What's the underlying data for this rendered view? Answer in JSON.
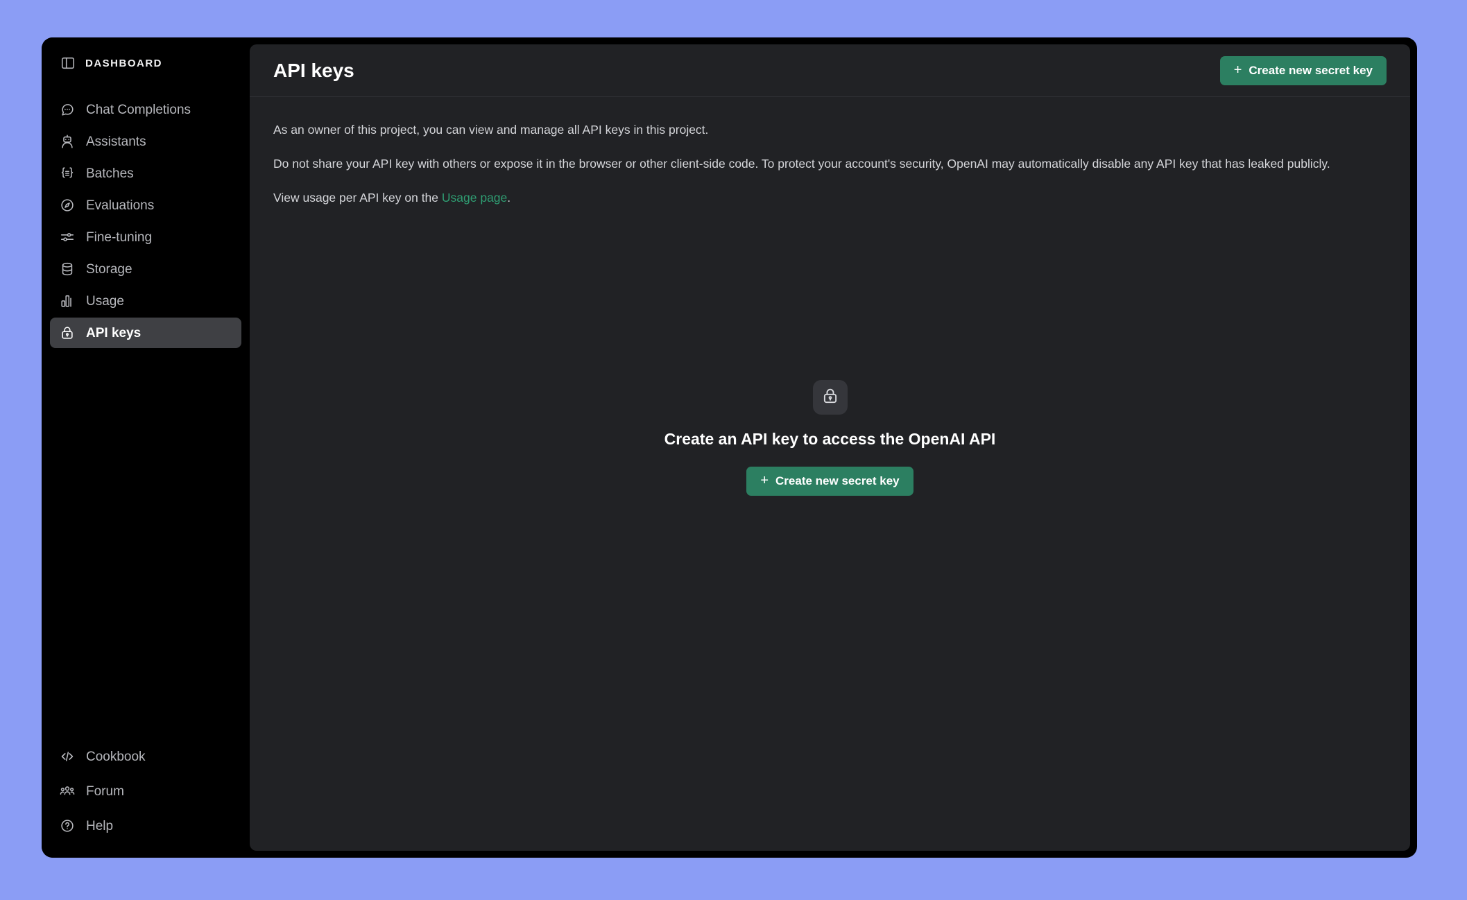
{
  "theme": {
    "desktop_bg": "#8b9df5",
    "window_bg": "#000000",
    "sidebar_bg": "#000000",
    "content_bg": "#212225",
    "accent_green": "#2c7f61",
    "link_green": "#2f9d72",
    "selected_item_bg": "#3f4044"
  },
  "sidebar": {
    "header": {
      "label": "DASHBOARD",
      "icon": "panel-left-icon"
    },
    "items": [
      {
        "label": "Chat Completions",
        "icon": "chat-bubble-icon",
        "selected": false
      },
      {
        "label": "Assistants",
        "icon": "robot-icon",
        "selected": false
      },
      {
        "label": "Batches",
        "icon": "braces-list-icon",
        "selected": false
      },
      {
        "label": "Evaluations",
        "icon": "compass-icon",
        "selected": false
      },
      {
        "label": "Fine-tuning",
        "icon": "sliders-icon",
        "selected": false
      },
      {
        "label": "Storage",
        "icon": "database-icon",
        "selected": false
      },
      {
        "label": "Usage",
        "icon": "bar-chart-icon",
        "selected": false
      },
      {
        "label": "API keys",
        "icon": "lock-icon",
        "selected": true
      }
    ],
    "bottom_items": [
      {
        "label": "Cookbook",
        "icon": "code-brackets-icon"
      },
      {
        "label": "Forum",
        "icon": "people-group-icon"
      },
      {
        "label": "Help",
        "icon": "question-circle-icon"
      }
    ]
  },
  "header": {
    "title": "API keys",
    "create_button_label": "Create new secret key",
    "create_button_plus": "+"
  },
  "body": {
    "paragraph_1": "As an owner of this project, you can view and manage all API keys in this project.",
    "paragraph_2": "Do not share your API key with others or expose it in the browser or other client-side code. To protect your account's security, OpenAI may automatically disable any API key that has leaked publicly.",
    "paragraph_3_prefix": "View usage per API key on the ",
    "paragraph_3_link": "Usage page",
    "paragraph_3_suffix": "."
  },
  "empty_state": {
    "icon": "lock-icon",
    "title": "Create an API key to access the OpenAI API",
    "button_label": "Create new secret key",
    "button_plus": "+"
  }
}
